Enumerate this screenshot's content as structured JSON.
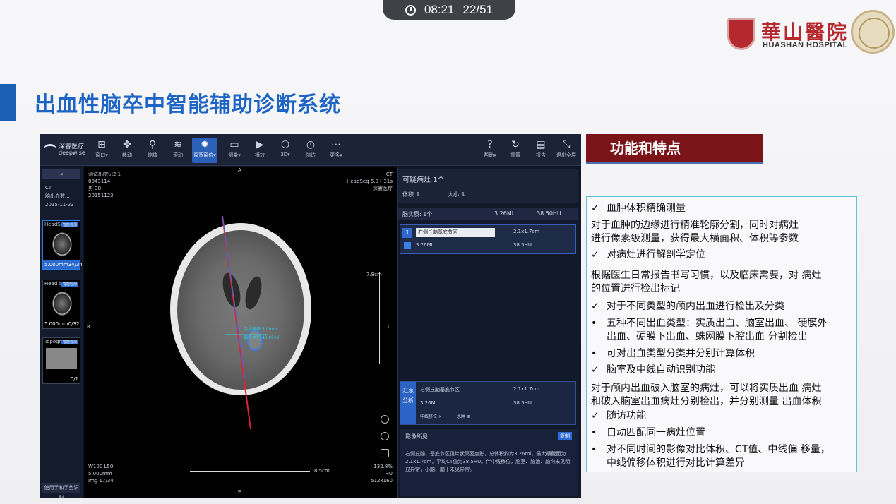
{
  "status": {
    "time": "08:21",
    "page": "22/51"
  },
  "hospital": {
    "name_cn": "華山醫院",
    "name_en": "HUASHAN HOSPITAL"
  },
  "title": "出血性脑卒中智能辅助诊断系统",
  "app": {
    "logo_cn": "深睿医疗",
    "logo_en": "deepwise",
    "toolbar": [
      {
        "label": "窗口▾",
        "icon": "grid-icon"
      },
      {
        "label": "移动",
        "icon": "move-icon"
      },
      {
        "label": "缩放",
        "icon": "zoom-icon"
      },
      {
        "label": "滚动",
        "icon": "layers-icon"
      },
      {
        "label": "窗宽窗位▾",
        "icon": "contrast-icon"
      },
      {
        "label": "测量▾",
        "icon": "measure-icon"
      },
      {
        "label": "播放",
        "icon": "play-icon"
      },
      {
        "label": "3D▾",
        "icon": "cube-icon"
      },
      {
        "label": "随访",
        "icon": "clock-icon"
      },
      {
        "label": "更多▾",
        "icon": "more-icon"
      }
    ],
    "toolbar_right": [
      {
        "label": "帮助▾",
        "icon": "help-icon"
      },
      {
        "label": "重置",
        "icon": "reset-icon"
      },
      {
        "label": "报告",
        "icon": "report-icon"
      },
      {
        "label": "退出全屏",
        "icon": "exit-fullscreen-icon"
      }
    ],
    "left": {
      "collapse": "«",
      "modality": "CT",
      "study": "脑出血数...",
      "date": "2015-11-23",
      "series1": {
        "label": "HeadSe",
        "tag": "智能检测",
        "thickness": "5.000mm",
        "count": "34/34"
      },
      "series2": {
        "label": "Head 5",
        "tag": "智能检测",
        "thickness": "5.000mm",
        "count": "0/32"
      },
      "series3": {
        "label": "Topogra...",
        "tag": "智能检测",
        "count": "0/1"
      },
      "bottom_button": "使用手和手势识别"
    },
    "viewer": {
      "tl1": "测试出院记2.1",
      "tl2": "0043114",
      "tl3": "男 38",
      "tl4": "20151123",
      "tr1": "CT",
      "tr2": "HeadSeq 5.0 H31s",
      "tr3": "深睿医疗",
      "top_marker": "A",
      "bottom_marker": "P",
      "left_marker": "R",
      "right_marker": "L",
      "scale_v": "7.8cm",
      "scale_h": "8.5cm",
      "measure1": "中线偏移 5.0mm",
      "measure2": "偏移体积 48.05ml",
      "bl1": "W100 L50",
      "bl2": "5.000mm",
      "bl3": "Img 17/34",
      "br1": "132.8%",
      "br2": "HU",
      "br3": "512x160"
    },
    "right": {
      "head_title": "可疑病灶",
      "head_count": "1个",
      "sort1": "体积 ⇕",
      "sort2": "大小 ⇕",
      "sub_label": "脑实质:",
      "sub_count": "1个",
      "sub_volume": "3.26ML",
      "sub_hu": "38.50HU",
      "lesion": {
        "index": "1",
        "location": "右侧丘脑基底节区",
        "size": "2.1x1.7cm",
        "volume": "3.26ML",
        "hu": "38.5HU"
      },
      "summary": {
        "label1": "汇总",
        "label2": "分析",
        "location": "右侧丘脑基底节区",
        "size": "2.1x1.7cm",
        "volume": "3.26ML",
        "hu": "38.5HU",
        "tag1": "中线移位 ×",
        "tag2": "水肿 ⊞"
      },
      "finding_title": "影像所见",
      "finding_button": "复制",
      "finding_text": "右侧丘脑、基底节区见片状高密度影，总体积约为3.26ml，最大横截面为2.1x1.7cm，平均CT值为38.5HU。伴中线移位，脑室、脑池、脑沟未见明显异常，小脑、脑干未见异常。"
    }
  },
  "features": {
    "header": "功能和特点",
    "lines": [
      {
        "mark": "✓",
        "text": "血肿体积精确测量"
      },
      {
        "mark": "",
        "text": "对于血肿的边缘进行精准轮廓分割，同时对病灶"
      },
      {
        "mark": "",
        "text": "进行像素级测量，获得最大横面积、体积等参数"
      },
      {
        "mark": "✓",
        "text": "对病灶进行解剖学定位"
      },
      {
        "mark": "",
        "text": "根据医生日常报告书写习惯，以及临床需要，对 病灶"
      },
      {
        "mark": "",
        "text": "的位置进行检出标记"
      },
      {
        "mark": "✓",
        "text": "对于不同类型的颅内出血进行检出及分类"
      },
      {
        "mark": "•",
        "text": "五种不同出血类型：实质出血、脑室出血、 硬膜外"
      },
      {
        "mark": "",
        "text": "出血、硬膜下出血、蛛网膜下腔出血 分割检出"
      },
      {
        "mark": "•",
        "text": "可对出血类型分类并分别计算体积"
      },
      {
        "mark": "✓",
        "text": "脑室及中线自动识别功能"
      },
      {
        "mark": "",
        "text": "对于颅内出血破入脑室的病灶，可以将实质出血 病灶"
      },
      {
        "mark": "",
        "text": "和破入脑室出血病灶分别检出，并分别测量 出血体积"
      },
      {
        "mark": "✓",
        "text": "随访功能"
      },
      {
        "mark": "•",
        "text": "自动匹配同一病灶位置"
      },
      {
        "mark": "•",
        "text": "对不同时间的影像对比体积、CT值、中线偏 移量，"
      },
      {
        "mark": "",
        "text": "中线偏移体积进行对比计算差异"
      }
    ]
  }
}
